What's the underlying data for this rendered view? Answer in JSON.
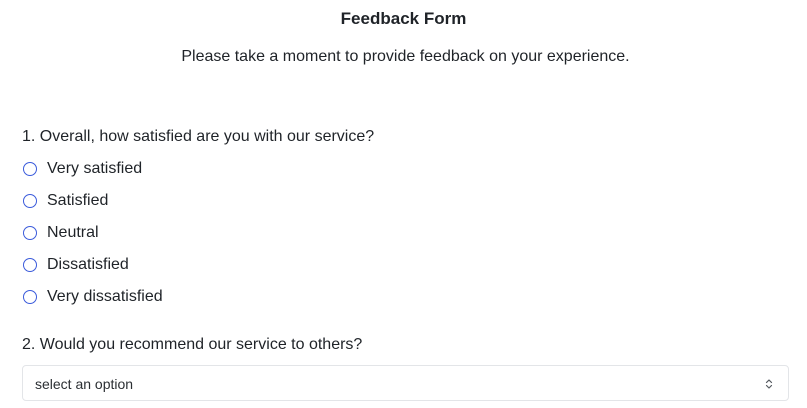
{
  "form": {
    "title": "Feedback Form",
    "subtitle": "Please take a moment to provide feedback on your experience."
  },
  "question1": {
    "label": "1. Overall, how satisfied are you with our service?",
    "options": [
      "Very satisfied",
      "Satisfied",
      "Neutral",
      "Dissatisfied",
      "Very dissatisfied"
    ],
    "selected": null
  },
  "question2": {
    "label": "2. Would you recommend our service to others?",
    "select_value": "select an option"
  },
  "icons": {
    "radio": "radio-unselected-icon",
    "select": "chevron-up-down-icon"
  },
  "colors": {
    "radio_border": "#3b5bdb",
    "select_border": "#e3e5e8"
  }
}
